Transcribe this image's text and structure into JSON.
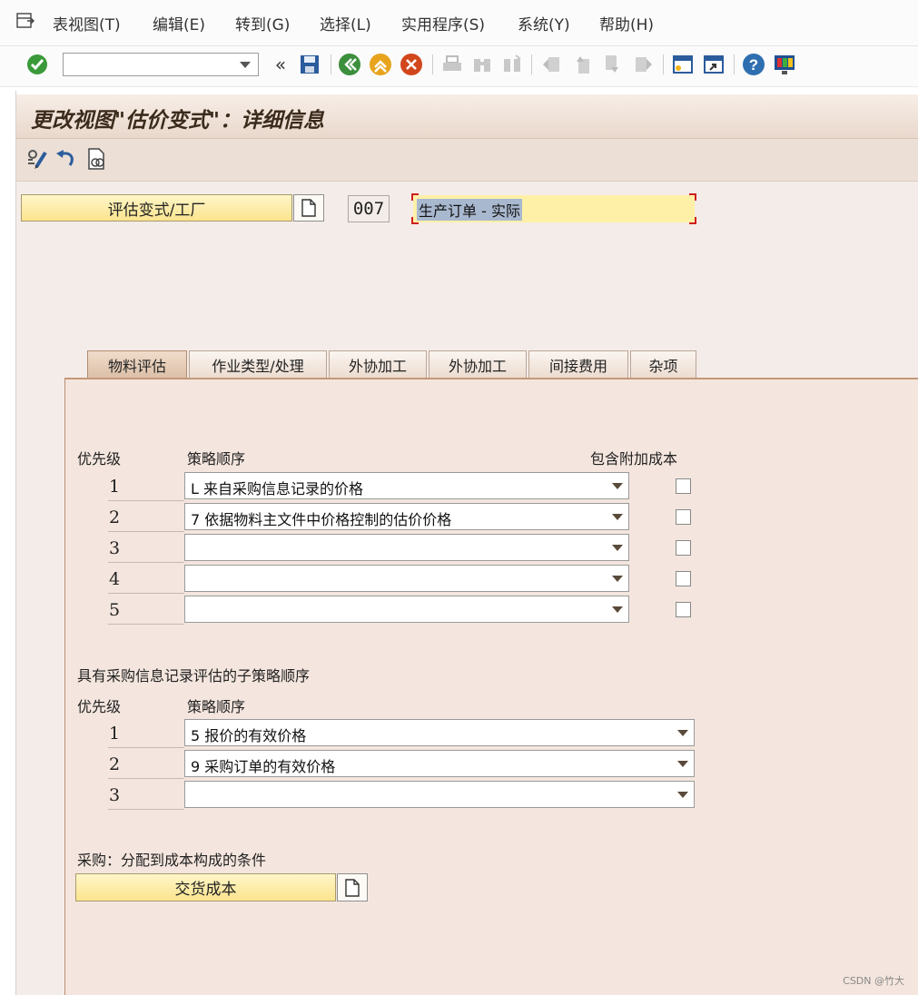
{
  "menu": {
    "items": [
      {
        "label": "表视图(T)"
      },
      {
        "label": "编辑(E)"
      },
      {
        "label": "转到(G)"
      },
      {
        "label": "选择(L)"
      },
      {
        "label": "实用程序(S)"
      },
      {
        "label": "系统(Y)"
      },
      {
        "label": "帮助(H)"
      }
    ]
  },
  "toolbar": {
    "command_value": "",
    "icons": [
      "enter-icon",
      "back-double-icon",
      "save-icon",
      "back-icon",
      "exit-icon",
      "cancel-icon",
      "print-icon",
      "find-icon",
      "find-next-icon",
      "first-page-icon",
      "previous-page-icon",
      "next-page-icon",
      "last-page-icon",
      "new-session-icon",
      "shortcut-icon",
      "help-icon",
      "customize-layout-icon"
    ]
  },
  "page": {
    "title": "更改视图\"估价变式\"：详细信息"
  },
  "header": {
    "valuation_button": "评估变式/工厂",
    "code": "007",
    "description": "生产订单 - 实际"
  },
  "tabs": [
    {
      "label": "物料评估",
      "active": true
    },
    {
      "label": "作业类型/处理"
    },
    {
      "label": "外协加工"
    },
    {
      "label": "外协加工"
    },
    {
      "label": "间接费用"
    },
    {
      "label": "杂项"
    }
  ],
  "strategy": {
    "priority_header": "优先级",
    "sequence_header": "策略顺序",
    "surcharge_header": "包含附加成本",
    "rows": [
      {
        "priority": "1",
        "value": "L 来自采购信息记录的价格",
        "checked": false
      },
      {
        "priority": "2",
        "value": "7 依据物料主文件中价格控制的估价价格",
        "checked": false
      },
      {
        "priority": "3",
        "value": "",
        "checked": false
      },
      {
        "priority": "4",
        "value": "",
        "checked": false
      },
      {
        "priority": "5",
        "value": "",
        "checked": false
      }
    ]
  },
  "sub_strategy": {
    "section_title": "具有采购信息记录评估的子策略顺序",
    "priority_header": "优先级",
    "sequence_header": "策略顺序",
    "rows": [
      {
        "priority": "1",
        "value": "5 报价的有效价格"
      },
      {
        "priority": "2",
        "value": "9 采购订单的有效价格"
      },
      {
        "priority": "3",
        "value": ""
      }
    ]
  },
  "purchasing": {
    "section_title": "采购：分配到成本构成的条件",
    "button_label": "交货成本"
  },
  "footer": {
    "credit": "CSDN @竹大"
  }
}
